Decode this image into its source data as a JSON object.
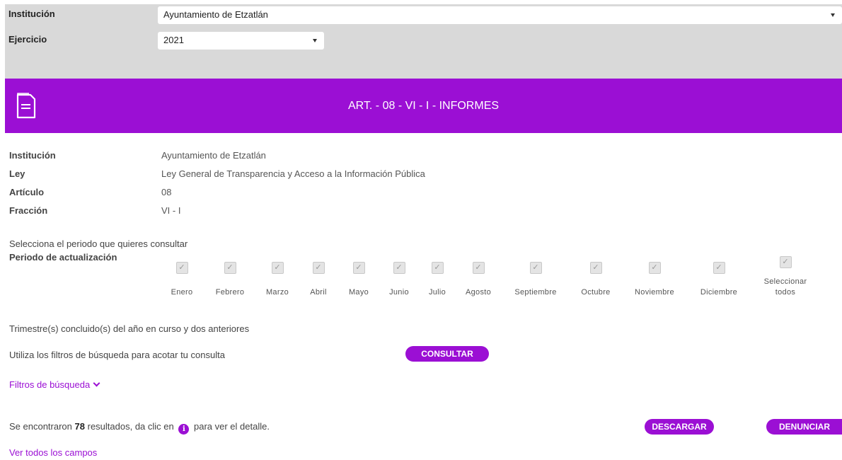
{
  "filters": {
    "institucion_label": "Institución",
    "institucion_value": "Ayuntamiento de Etzatlán",
    "ejercicio_label": "Ejercicio",
    "ejercicio_value": "2021"
  },
  "banner": {
    "title": "ART. - 08 - VI - I - INFORMES",
    "icon": "document-icon",
    "color": "#9b0fd4"
  },
  "info": [
    {
      "label": "Institución",
      "value": "Ayuntamiento de Etzatlán"
    },
    {
      "label": "Ley",
      "value": "Ley General de Transparencia y Acceso a la Información Pública"
    },
    {
      "label": "Artículo",
      "value": "08"
    },
    {
      "label": "Fracción",
      "value": "VI - I"
    }
  ],
  "period": {
    "prompt": "Selecciona el periodo que quieres consultar",
    "label": "Periodo de actualización",
    "months": [
      "Enero",
      "Febrero",
      "Marzo",
      "Abril",
      "Mayo",
      "Junio",
      "Julio",
      "Agosto",
      "Septiembre",
      "Octubre",
      "Noviembre",
      "Diciembre"
    ],
    "select_all_1": "Seleccionar",
    "select_all_2": "todos"
  },
  "notes": {
    "trimestres": "Trimestre(s) concluido(s) del año en curso y dos anteriores",
    "filters_hint": "Utiliza los filtros de búsqueda para acotar tu consulta",
    "consultar": "CONSULTAR",
    "filtros_link": "Filtros de búsqueda"
  },
  "results": {
    "prefix": "Se encontraron",
    "count": "78",
    "middle": "resultados, da clic en",
    "suffix": "para ver el detalle.",
    "info_glyph": "i",
    "descargar": "DESCARGAR",
    "denunciar": "DENUNCIAR",
    "ver_todos": "Ver todos los campos"
  }
}
